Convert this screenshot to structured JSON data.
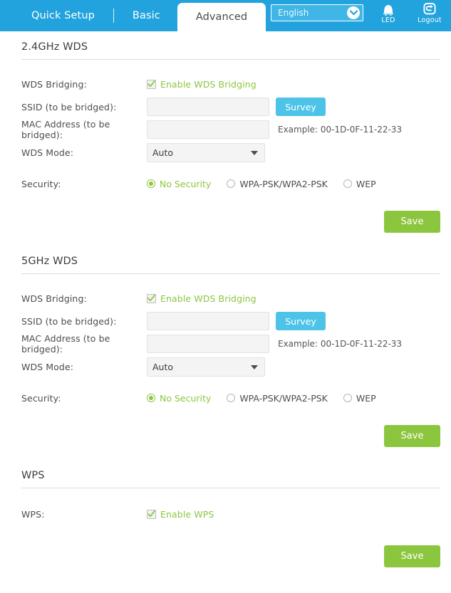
{
  "header": {
    "tabs": [
      {
        "label": "Quick Setup",
        "active": false
      },
      {
        "label": "Basic",
        "active": false
      },
      {
        "label": "Advanced",
        "active": true
      }
    ],
    "language": {
      "selected": "English",
      "options": [
        "English"
      ]
    },
    "icons": [
      {
        "name": "led-icon",
        "label": "LED"
      },
      {
        "name": "logout-icon",
        "label": "Logout"
      }
    ]
  },
  "colors": {
    "header_blue": "#22a3dd",
    "accent_green": "#8cc63e",
    "survey_blue": "#4ec3e8",
    "input_gray": "#f4f4f4",
    "text_dark": "#4d4d4d"
  },
  "sections": {
    "wds24": {
      "title": "2.4GHz WDS",
      "bridging_label": "WDS Bridging:",
      "bridging_checkbox_label": "Enable WDS Bridging",
      "bridging_checked": true,
      "ssid_label": "SSID (to be bridged):",
      "ssid_value": "",
      "ssid_placeholder": "",
      "survey_label": "Survey",
      "mac_label": "MAC Address (to be bridged):",
      "mac_value": "",
      "mac_placeholder": "",
      "mac_hint": "Example: 00-1D-0F-11-22-33",
      "mode_label": "WDS Mode:",
      "mode_selected": "Auto",
      "mode_options": [
        "Auto"
      ],
      "security_label": "Security:",
      "security_options": [
        {
          "label": "No Security",
          "checked": true
        },
        {
          "label": "WPA-PSK/WPA2-PSK",
          "checked": false
        },
        {
          "label": "WEP",
          "checked": false
        }
      ],
      "save_label": "Save"
    },
    "wds5": {
      "title": "5GHz WDS",
      "bridging_label": "WDS Bridging:",
      "bridging_checkbox_label": "Enable WDS Bridging",
      "bridging_checked": true,
      "ssid_label": "SSID (to be bridged):",
      "ssid_value": "",
      "ssid_placeholder": "",
      "survey_label": "Survey",
      "mac_label": "MAC Address (to be bridged):",
      "mac_value": "",
      "mac_placeholder": "",
      "mac_hint": "Example: 00-1D-0F-11-22-33",
      "mode_label": "WDS Mode:",
      "mode_selected": "Auto",
      "mode_options": [
        "Auto"
      ],
      "security_label": "Security:",
      "security_options": [
        {
          "label": "No Security",
          "checked": true
        },
        {
          "label": "WPA-PSK/WPA2-PSK",
          "checked": false
        },
        {
          "label": "WEP",
          "checked": false
        }
      ],
      "save_label": "Save"
    },
    "wps": {
      "title": "WPS",
      "wps_label": "WPS:",
      "wps_checkbox_label": "Enable WPS",
      "wps_checked": true,
      "save_label": "Save"
    }
  }
}
